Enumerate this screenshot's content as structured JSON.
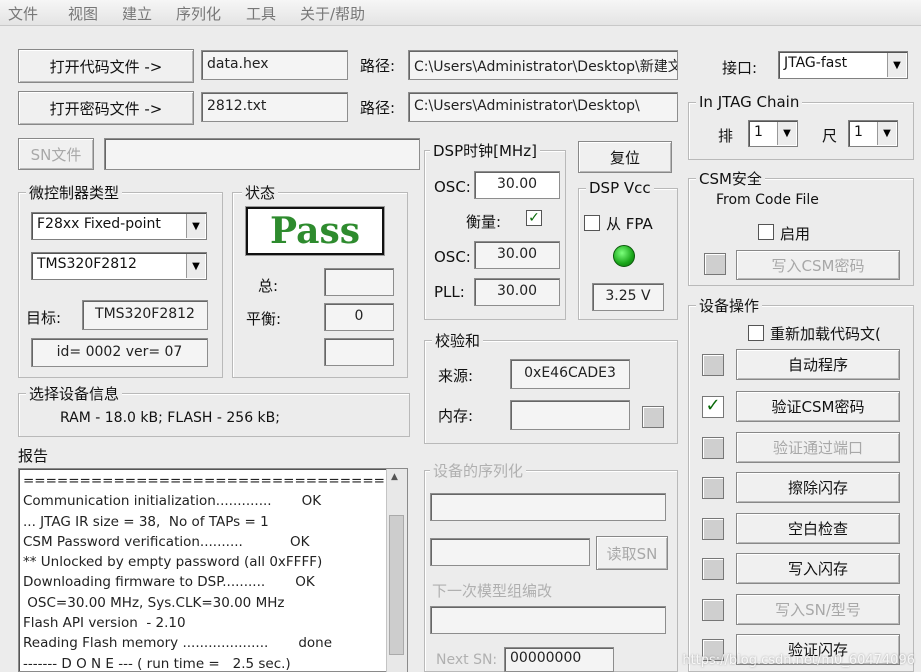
{
  "menu": [
    "文件",
    "视图",
    "建立",
    "序列化",
    "工具",
    "关于/帮助"
  ],
  "files": {
    "open_code_button": "打开代码文件 ->",
    "code_file": "data.hex",
    "path_label": "路径:",
    "code_path": "C:\\Users\\Administrator\\Desktop\\新建文",
    "open_password_button": "打开密码文件 ->",
    "password_file": "2812.txt",
    "password_path": "C:\\Users\\Administrator\\Desktop\\",
    "sn_button": "SN文件",
    "sn_value": ""
  },
  "interface": {
    "label": "接口:",
    "value": "JTAG-fast"
  },
  "jtag_chain": {
    "title": "In JTAG Chain",
    "row_label": "排",
    "row_value": "1",
    "col_label": "尺",
    "col_value": "1"
  },
  "mcu_type": {
    "title": "微控制器类型",
    "family": "F28xx Fixed-point",
    "device": "TMS320F2812",
    "target_label": "目标:",
    "target_value": "TMS320F2812",
    "id_info": "id= 0002 ver= 07"
  },
  "status": {
    "title": "状态",
    "result": "Pass",
    "total_label": "总:",
    "total_value": "",
    "balance_label": "平衡:",
    "balance_value": "0",
    "extra_value": ""
  },
  "dsp_clock": {
    "title": "DSP时钟[MHz]",
    "osc_label": "OSC:",
    "osc_value": "30.00",
    "measure_label": "衡量:",
    "measure_checked": true,
    "osc2_label": "OSC:",
    "osc2_value": "30.00",
    "pll_label": "PLL:",
    "pll_value": "30.00"
  },
  "reset_button": "复位",
  "dsp_vcc": {
    "title": "DSP Vcc",
    "from_fpa_label": "从 FPA",
    "from_fpa_checked": false,
    "voltage": "3.25 V",
    "led_color": "#1aa61a"
  },
  "csm": {
    "title": "CSM安全",
    "from_code_file": "From Code File",
    "enable_label": "启用",
    "write_csm_button": "写入CSM密码"
  },
  "checksum": {
    "title": "校验和",
    "source_label": "来源:",
    "source_value": "0xE46CADE3",
    "memory_label": "内存:",
    "memory_value": ""
  },
  "device_info": {
    "title": "选择设备信息",
    "text": "RAM -  18.0 kB;    FLASH - 256 kB;"
  },
  "serialization": {
    "title": "设备的序列化",
    "field1": "",
    "field2": "",
    "read_sn_button": "读取SN",
    "next_model_label": "下一次模型组编改",
    "field3": "",
    "next_sn_label": "Next SN:",
    "next_sn_value": "00000000"
  },
  "device_ops": {
    "title": "设备操作",
    "reload_label": "重新加载代码文(",
    "reload_checked": false,
    "buttons": [
      {
        "label": "自动程序",
        "checked": false,
        "enabled": true
      },
      {
        "label": "验证CSM密码",
        "checked": true,
        "enabled": true
      },
      {
        "label": "验证通过端口",
        "checked": false,
        "enabled": false
      },
      {
        "label": "擦除闪存",
        "checked": false,
        "enabled": true
      },
      {
        "label": "空白检查",
        "checked": false,
        "enabled": true
      },
      {
        "label": "写入闪存",
        "checked": false,
        "enabled": true
      },
      {
        "label": "写入SN/型号",
        "checked": false,
        "enabled": false
      },
      {
        "label": "验证闪存",
        "checked": false,
        "enabled": true
      }
    ]
  },
  "report": {
    "title": "报告",
    "lines": [
      "====================================",
      "Communication initialization.............       OK",
      "... JTAG IR size = 38,  No of TAPs = 1",
      "CSM Password verification..........           OK",
      "** Unlocked by empty password (all 0xFFFF)",
      "Downloading firmware to DSP..........       OK",
      " OSC=30.00 MHz, Sys.CLK=30.00 MHz",
      "Flash API version  - 2.10",
      "Reading Flash memory ....................       done",
      "------- D O N E --- ( run time =   2.5 sec.)"
    ]
  },
  "watermark": "https://blog.csdn.net/m0_60474096"
}
